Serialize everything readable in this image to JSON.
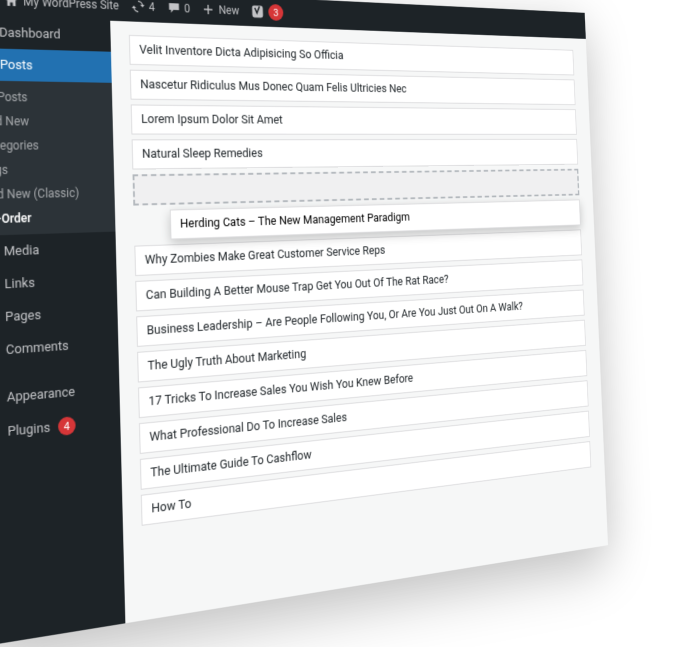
{
  "adminbar": {
    "site_name": "My WordPress Site",
    "refresh_count": "4",
    "comments_count": "0",
    "new_label": "New",
    "yoast_badge": "3"
  },
  "sidebar": {
    "dashboard": "Dashboard",
    "posts": "Posts",
    "posts_sub": {
      "all": "All Posts",
      "add_new": "Add New",
      "categories": "Categories",
      "tags": "Tags",
      "add_classic": "Add New (Classic)",
      "reorder": "Re-Order"
    },
    "media": "Media",
    "links": "Links",
    "pages": "Pages",
    "comments": "Comments",
    "appearance": "Appearance",
    "plugins": "Plugins",
    "plugins_badge": "4"
  },
  "posts": [
    "Velit Inventore Dicta Adipisicing So Officia",
    "Nascetur Ridiculus Mus Donec Quam Felis Ultricies Nec",
    "Lorem Ipsum Dolor Sit Amet",
    "Natural Sleep Remedies",
    "Herding Cats – The New Management Paradigm",
    "Why Zombies Make Great Customer Service Reps",
    "Can Building A Better Mouse Trap Get You Out Of The Rat Race?",
    "Business Leadership – Are People Following You, Or Are You Just Out On A Walk?",
    "The Ugly Truth About Marketing",
    "17 Tricks To Increase Sales You Wish You Knew Before",
    "What Professional Do To Increase Sales",
    "The Ultimate Guide To Cashflow",
    "How To"
  ]
}
